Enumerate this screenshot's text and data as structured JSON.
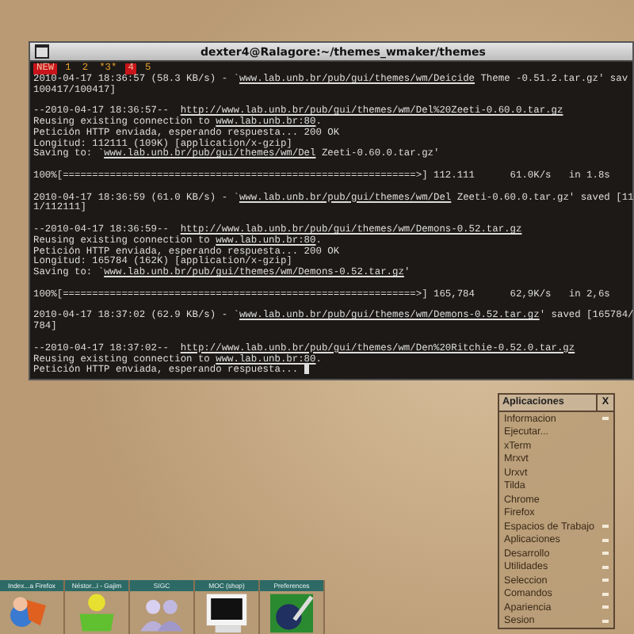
{
  "terminal": {
    "title": "dexter4@Ralagore:~/themes_wmaker/themes",
    "tabs": [
      {
        "label": "NEW",
        "highlighted": true
      },
      {
        "label": "1",
        "highlighted": false
      },
      {
        "label": "2",
        "highlighted": false
      },
      {
        "label": "*3*",
        "highlighted": false
      },
      {
        "label": "4",
        "highlighted": true
      },
      {
        "label": "5",
        "highlighted": false
      }
    ],
    "blocks": [
      [
        [
          {
            "text": "2010-04-17 18:36:57 (58.3 KB/s) - `",
            "link": false
          },
          {
            "text": "www.lab.unb.br/pub/gui/themes/wm/Deicide",
            "link": true
          },
          {
            "text": " Theme -0.51.2.tar.gz' sav",
            "link": false
          }
        ],
        [
          {
            "text": "100417/100417]",
            "link": false
          }
        ]
      ],
      [
        [
          {
            "text": "--2010-04-17 18:36:57--  ",
            "link": false
          },
          {
            "text": "http://www.lab.unb.br/pub/gui/themes/wm/Del%20Zeeti-0.60.0.tar.gz",
            "link": true
          }
        ],
        [
          {
            "text": "Reusing existing connection to ",
            "link": false
          },
          {
            "text": "www.lab.unb.br:80",
            "link": true
          },
          {
            "text": ".",
            "link": false
          }
        ],
        [
          {
            "text": "Petición HTTP enviada, esperando respuesta... 200 OK",
            "link": false
          }
        ],
        [
          {
            "text": "Longitud: 112111 (109K) [application/x-gzip]",
            "link": false
          }
        ],
        [
          {
            "text": "Saving to: `",
            "link": false
          },
          {
            "text": "www.lab.unb.br/pub/gui/themes/wm/Del",
            "link": true
          },
          {
            "text": " Zeeti-0.60.0.tar.gz'",
            "link": false
          }
        ]
      ],
      [
        [
          {
            "text": "100%[============================================================>] 112.111      61.0K/s   in 1.8s",
            "link": false
          }
        ]
      ],
      [
        [
          {
            "text": "2010-04-17 18:36:59 (61.0 KB/s) - `",
            "link": false
          },
          {
            "text": "www.lab.unb.br/pub/gui/themes/wm/Del",
            "link": true
          },
          {
            "text": " Zeeti-0.60.0.tar.gz' saved [11",
            "link": false
          }
        ],
        [
          {
            "text": "1/112111]",
            "link": false
          }
        ]
      ],
      [
        [
          {
            "text": "--2010-04-17 18:36:59--  ",
            "link": false
          },
          {
            "text": "http://www.lab.unb.br/pub/gui/themes/wm/Demons-0.52.tar.gz",
            "link": true
          }
        ],
        [
          {
            "text": "Reusing existing connection to ",
            "link": false
          },
          {
            "text": "www.lab.unb.br:80",
            "link": true
          },
          {
            "text": ".",
            "link": false
          }
        ],
        [
          {
            "text": "Petición HTTP enviada, esperando respuesta... 200 OK",
            "link": false
          }
        ],
        [
          {
            "text": "Longitud: 165784 (162K) [application/x-gzip]",
            "link": false
          }
        ],
        [
          {
            "text": "Saving to: `",
            "link": false
          },
          {
            "text": "www.lab.unb.br/pub/gui/themes/wm/Demons-0.52.tar.gz",
            "link": true
          },
          {
            "text": "'",
            "link": false
          }
        ]
      ],
      [
        [
          {
            "text": "100%[============================================================>] 165,784      62,9K/s   in 2,6s",
            "link": false
          }
        ]
      ],
      [
        [
          {
            "text": "2010-04-17 18:37:02 (62.9 KB/s) - `",
            "link": false
          },
          {
            "text": "www.lab.unb.br/pub/gui/themes/wm/Demons-0.52.tar.gz",
            "link": true
          },
          {
            "text": "' saved [165784/",
            "link": false
          }
        ],
        [
          {
            "text": "784]",
            "link": false
          }
        ]
      ],
      [
        [
          {
            "text": "--2010-04-17 18:37:02--  ",
            "link": false
          },
          {
            "text": "http://www.lab.unb.br/pub/gui/themes/wm/Den%20Ritchie-0.52.0.tar.gz",
            "link": true
          }
        ],
        [
          {
            "text": "Reusing existing connection to ",
            "link": false
          },
          {
            "text": "www.lab.unb.br:80",
            "link": true
          },
          {
            "text": ".",
            "link": false
          }
        ],
        [
          {
            "text": "Petición HTTP enviada, esperando respuesta... ",
            "link": false
          }
        ]
      ]
    ]
  },
  "menu": {
    "title": "Aplicaciones",
    "close": "X",
    "items": [
      {
        "label": "Informacion",
        "submenu": true
      },
      {
        "label": "Ejecutar...",
        "submenu": false
      },
      {
        "label": "xTerm",
        "submenu": false
      },
      {
        "label": "Mrxvt",
        "submenu": false
      },
      {
        "label": "Urxvt",
        "submenu": false
      },
      {
        "label": "Tilda",
        "submenu": false
      },
      {
        "label": "Chrome",
        "submenu": false
      },
      {
        "label": "Firefox",
        "submenu": false
      },
      {
        "label": "Espacios de Trabajo",
        "submenu": true
      },
      {
        "label": "Aplicaciones",
        "submenu": true
      },
      {
        "label": "Desarrollo",
        "submenu": true
      },
      {
        "label": "Utilidades",
        "submenu": true
      },
      {
        "label": "Seleccion",
        "submenu": true
      },
      {
        "label": "Comandos",
        "submenu": true
      },
      {
        "label": "Apariencia",
        "submenu": true
      },
      {
        "label": "Sesion",
        "submenu": true
      }
    ]
  },
  "dock": [
    {
      "label": "Index...a Firefox",
      "kind": "fox"
    },
    {
      "label": "Néstor...i - Gajim",
      "kind": "person"
    },
    {
      "label": "SIGC",
      "kind": "people"
    },
    {
      "label": "MOC (shop)",
      "kind": "monitor"
    },
    {
      "label": "Preferences",
      "kind": "prefs"
    }
  ]
}
